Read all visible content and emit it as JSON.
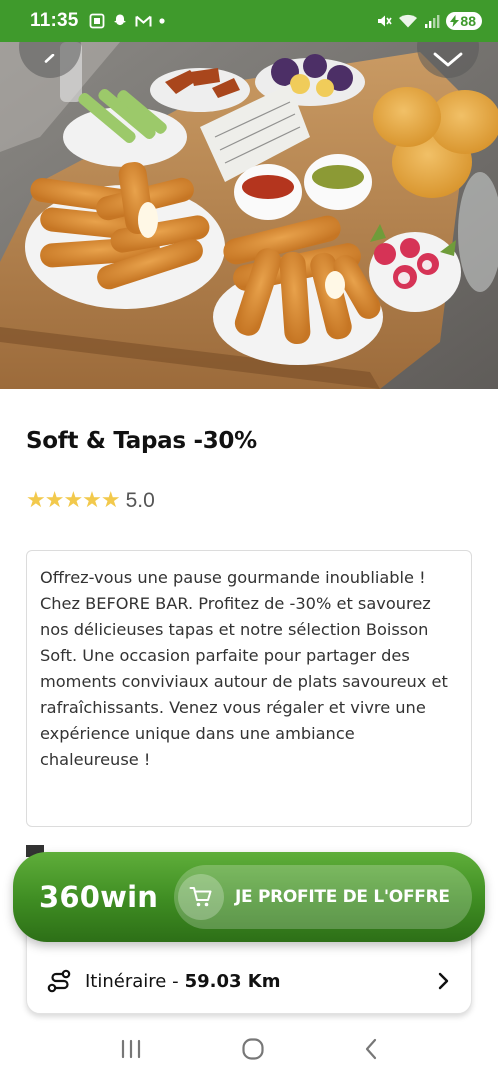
{
  "status_bar": {
    "time": "11:35",
    "battery": "88"
  },
  "offer": {
    "title": "Soft & Tapas -30%",
    "stars": "★★★★★",
    "rating": "5.0",
    "description": "Offrez-vous une pause gourmande inoubliable ! Chez BEFORE BAR. Profitez de -30% et savourez nos délicieuses tapas et notre sélection Boisson Soft. Une occasion parfaite pour partager des moments conviviaux autour de plats savoureux et rafraîchissants. Venez vous régaler et vivre une expérience unique dans une ambiance chaleureuse !"
  },
  "cta": {
    "price": "360win",
    "button_label": "JE PROFITE DE L'OFFRE"
  },
  "itinerary": {
    "label": "Itinéraire -",
    "distance": "59.03 Km"
  },
  "colors": {
    "brand_green": "#3f9a2c",
    "star_yellow": "#f2c94c"
  },
  "icons": {
    "back": "chevron-left-icon",
    "favorite": "chevron-down-icon",
    "cart": "cart-icon",
    "route": "route-icon",
    "next": "chevron-right-icon"
  }
}
